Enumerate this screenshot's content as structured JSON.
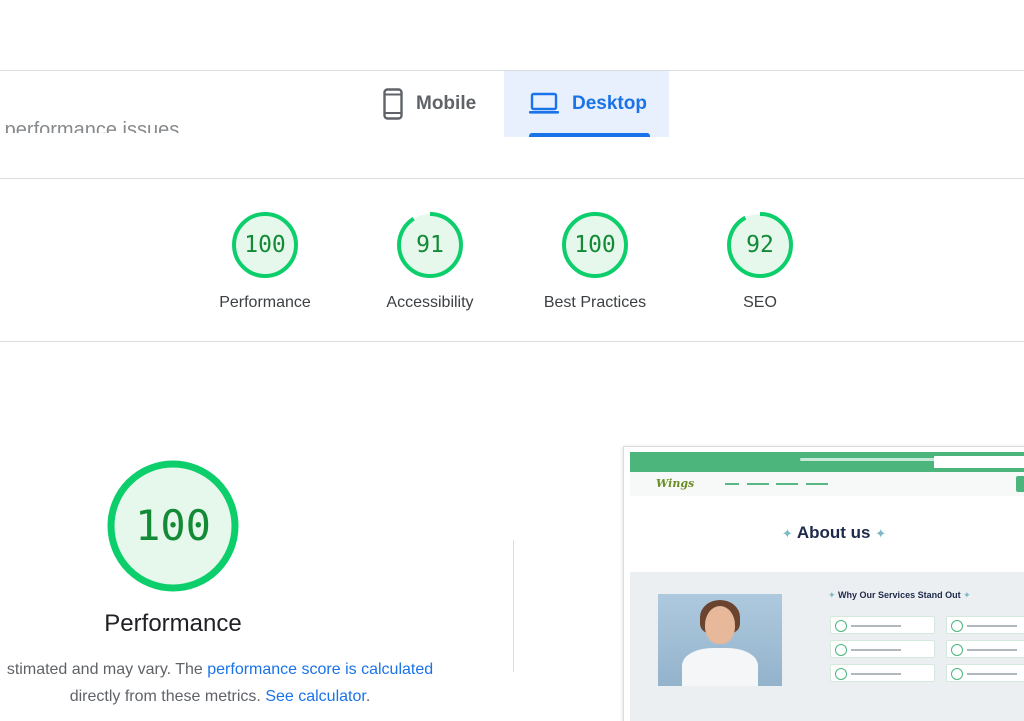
{
  "header": {
    "partial_heading": "o performance issues",
    "tabs": [
      {
        "label": "Mobile",
        "icon": "smartphone-icon",
        "selected": false
      },
      {
        "label": "Desktop",
        "icon": "laptop-icon",
        "selected": true
      }
    ]
  },
  "scores": [
    {
      "value": "100",
      "label": "Performance",
      "fraction": 1.0
    },
    {
      "value": "91",
      "label": "Accessibility",
      "fraction": 0.91
    },
    {
      "value": "100",
      "label": "Best Practices",
      "fraction": 1.0
    },
    {
      "value": "92",
      "label": "SEO",
      "fraction": 0.92
    }
  ],
  "performance": {
    "score": "100",
    "title": "Performance",
    "desc_prefix": "stimated and may vary. The ",
    "desc_link1": "performance score is calculated",
    "desc_mid": "directly from these metrics. ",
    "desc_link2": "See calculator",
    "desc_end": "."
  },
  "screenshot": {
    "logo": "Wings",
    "heading": "About us",
    "subheading": "Why Our Services Stand Out"
  },
  "colors": {
    "pass_green": "#0cce6b",
    "pass_fill": "#e6f7ec",
    "score_text": "#138a36",
    "accent_blue": "#1a73e8",
    "selected_tab_bg": "#e8f0fe",
    "site_green": "#4cb57c"
  }
}
